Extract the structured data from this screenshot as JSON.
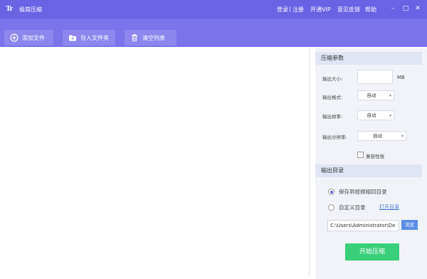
{
  "titlebar": {
    "logo": "Tr",
    "title": "极简压缩",
    "login": "登录",
    "separator": "|",
    "register": "注册",
    "vip": "开通VIP",
    "feedback": "意见反馈",
    "help": "帮助",
    "minimize": "–",
    "maximize": "□",
    "close": "✕"
  },
  "toolbar": {
    "add_file": "添加文件",
    "import_folder": "导入文件夹",
    "clear_list": "清空列表"
  },
  "panel": {
    "compress_params": "压缩参数",
    "output_size_label": "输出大小:",
    "output_size_value": "",
    "size_unit": "MB",
    "output_format_label": "输出格式:",
    "output_format_value": "自动",
    "output_framerate_label": "输出帧率:",
    "output_framerate_value": "自动",
    "output_resolution_label": "输出分辨率:",
    "output_resolution_value": "自动",
    "compat_label": "兼容性强",
    "output_dir_header": "输出目录",
    "save_same_dir": "保存到视频相同目录",
    "custom_dir": "自定义目录",
    "open_dir": "打开目录",
    "path_value": "C:\\Users\\Administrator\\De",
    "browse": "浏览",
    "start": "开始压缩"
  },
  "colors": {
    "titlebar": "#6a63e3",
    "toolbar": "#7a73ea",
    "start_button": "#39cf7a",
    "browse_button": "#5b8ee6",
    "link": "#4b7bd9"
  }
}
